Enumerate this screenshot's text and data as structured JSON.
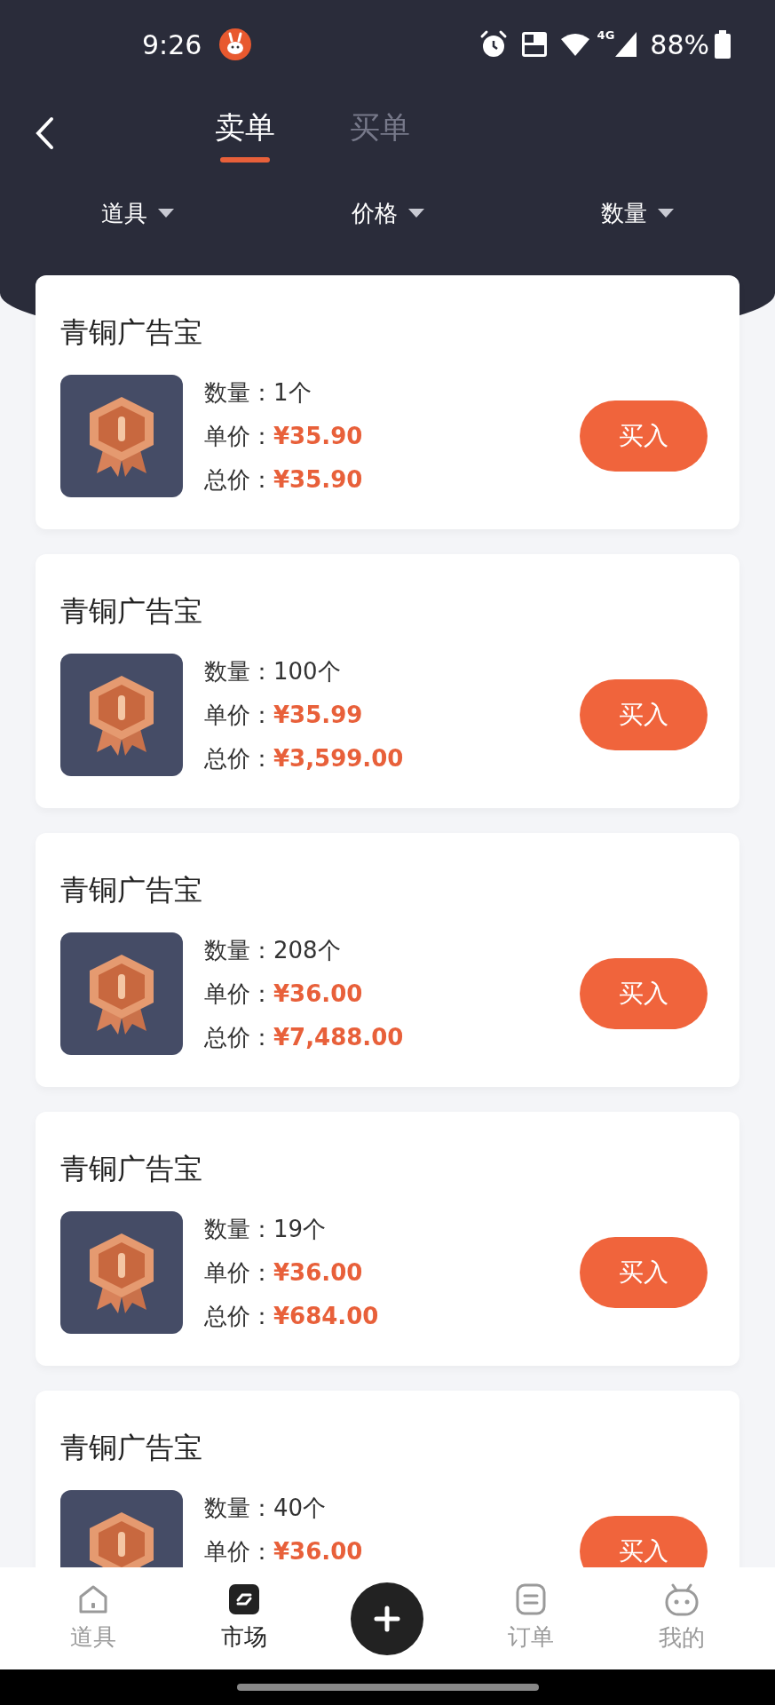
{
  "status_bar": {
    "time": "9:26",
    "network_label": "4G",
    "battery": "88%"
  },
  "tabs": [
    {
      "label": "卖单",
      "selected": true
    },
    {
      "label": "买单",
      "selected": false
    }
  ],
  "filters": [
    {
      "label": "道具"
    },
    {
      "label": "价格"
    },
    {
      "label": "数量"
    }
  ],
  "listings": [
    {
      "title": "青铜广告宝",
      "quantity_label": "数量：",
      "quantity": "1个",
      "unit_price_label": "单价：",
      "unit_price": "¥35.90",
      "total_label": "总价：",
      "total": "¥35.90",
      "button": "买入"
    },
    {
      "title": "青铜广告宝",
      "quantity_label": "数量：",
      "quantity": "100个",
      "unit_price_label": "单价：",
      "unit_price": "¥35.99",
      "total_label": "总价：",
      "total": "¥3,599.00",
      "button": "买入"
    },
    {
      "title": "青铜广告宝",
      "quantity_label": "数量：",
      "quantity": "208个",
      "unit_price_label": "单价：",
      "unit_price": "¥36.00",
      "total_label": "总价：",
      "total": "¥7,488.00",
      "button": "买入"
    },
    {
      "title": "青铜广告宝",
      "quantity_label": "数量：",
      "quantity": "19个",
      "unit_price_label": "单价：",
      "unit_price": "¥36.00",
      "total_label": "总价：",
      "total": "¥684.00",
      "button": "买入"
    },
    {
      "title": "青铜广告宝",
      "quantity_label": "数量：",
      "quantity": "40个",
      "unit_price_label": "单价：",
      "unit_price": "¥36.00",
      "button": "买入"
    }
  ],
  "bottom_nav": [
    {
      "kind": "home",
      "label": "道具",
      "selected": false
    },
    {
      "kind": "market",
      "label": "市场",
      "selected": true
    },
    {
      "kind": "add"
    },
    {
      "kind": "orders",
      "label": "订单",
      "selected": false
    },
    {
      "kind": "profile",
      "label": "我的",
      "selected": false
    }
  ]
}
